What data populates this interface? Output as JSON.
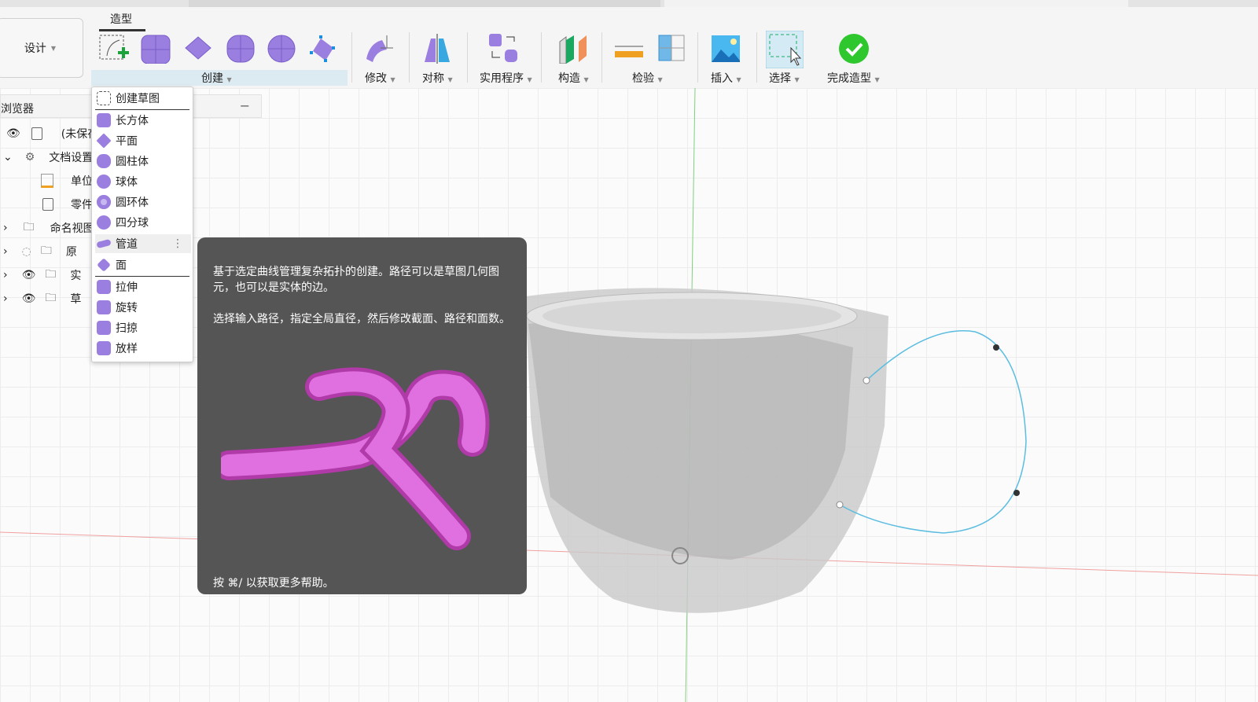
{
  "workspace": {
    "label": "设计"
  },
  "toolbar": {
    "active_tab": "造型",
    "groups": [
      {
        "label": "创建"
      },
      {
        "label": "修改"
      },
      {
        "label": "对称"
      },
      {
        "label": "实用程序"
      },
      {
        "label": "构造"
      },
      {
        "label": "检验"
      },
      {
        "label": "插入"
      },
      {
        "label": "选择"
      },
      {
        "label": "完成造型"
      }
    ],
    "colors": {
      "accent": "#9b7fe0",
      "create_bar": "#dcebf2",
      "finish": "#2ec72e"
    }
  },
  "browser": {
    "title": "浏览器",
    "items": [
      {
        "label": "(未保存"
      },
      {
        "label": "文档设置"
      },
      {
        "label": "单位"
      },
      {
        "label": "零件"
      },
      {
        "label": "命名视图"
      },
      {
        "label": "原"
      },
      {
        "label": "实"
      },
      {
        "label": "草"
      }
    ]
  },
  "create_menu": {
    "items": [
      {
        "label": "创建草图"
      },
      {
        "label": "长方体"
      },
      {
        "label": "平面"
      },
      {
        "label": "圆柱体"
      },
      {
        "label": "球体"
      },
      {
        "label": "圆环体"
      },
      {
        "label": "四分球"
      },
      {
        "label": "管道"
      },
      {
        "label": "面"
      },
      {
        "label": "拉伸"
      },
      {
        "label": "旋转"
      },
      {
        "label": "扫掠"
      },
      {
        "label": "放样"
      }
    ]
  },
  "tooltip": {
    "p1": "基于选定曲线管理复杂拓扑的创建。路径可以是草图几何图元，也可以是实体的边。",
    "p2": "选择输入路径，指定全局直径，然后修改截面、路径和面数。",
    "footer": "按 ⌘/ 以获取更多帮助。"
  }
}
